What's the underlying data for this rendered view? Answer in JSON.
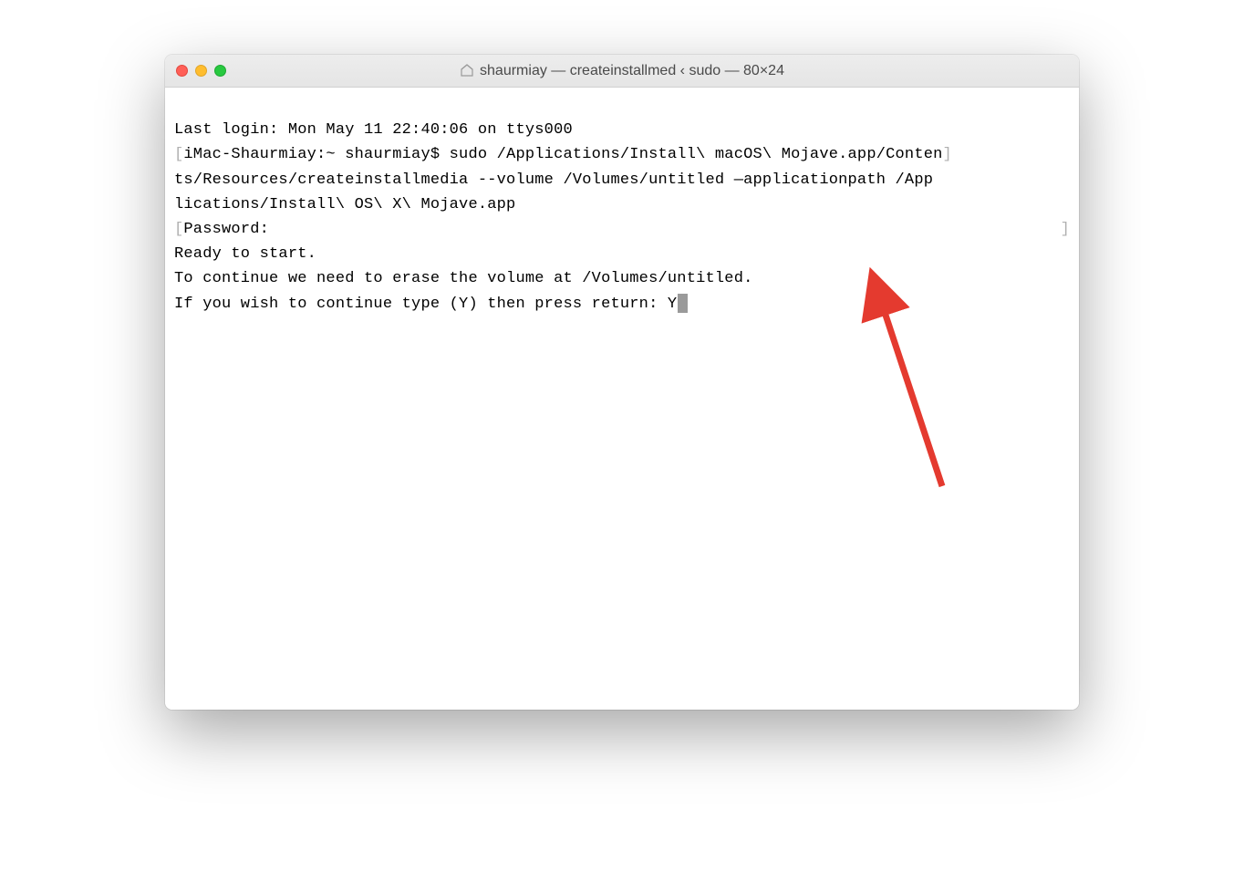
{
  "window": {
    "title": "shaurmiay — createinstallmed ‹ sudo — 80×24"
  },
  "terminal": {
    "line1": "Last login: Mon May 11 22:40:06 on ttys000",
    "line2_prefix": "[",
    "line2_prompt": "iMac-Shaurmiay:~ shaurmiay$ ",
    "line2_cmd": "sudo /Applications/Install\\ macOS\\ Mojave.app/Conten",
    "line2_suffix": "]",
    "line3": "ts/Resources/createinstallmedia --volume /Volumes/untitled —applicationpath /App",
    "line4": "lications/Install\\ OS\\ X\\ Mojave.app",
    "line5_prefix": "[",
    "line5_text": "Password:",
    "line5_suffix": "]",
    "line6": "Ready to start.",
    "line7": "To continue we need to erase the volume at /Volumes/untitled.",
    "line8": "If you wish to continue type (Y) then press return: Y"
  }
}
